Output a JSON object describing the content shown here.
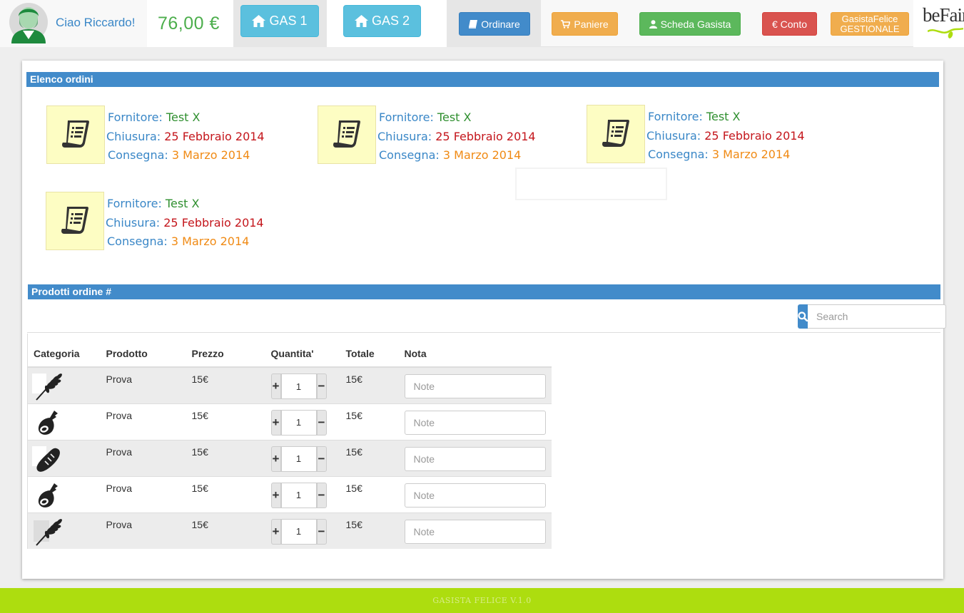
{
  "header": {
    "greeting": "Ciao Riccardo!",
    "balance": "76,00 €",
    "gas1_label": "GAS 1",
    "gas2_label": "GAS 2",
    "nav": {
      "ordinare": "Ordinare",
      "paniere": "Paniere",
      "scheda": "Scheda Gasista",
      "conto": "€ Conto",
      "gestionale_line1": "GasistaFelice",
      "gestionale_line2": "GESTIONALE"
    },
    "logo_text": "beFair"
  },
  "orders_section": {
    "title": "Elenco ordini",
    "labels": {
      "fornitore": "Fornitore:",
      "chiusura": "Chiusura:",
      "consegna": "Consegna:"
    },
    "orders": [
      {
        "fornitore": "Test X",
        "chiusura": "25 Febbraio 2014",
        "consegna": "3 Marzo 2014"
      },
      {
        "fornitore": "Test X",
        "chiusura": "25 Febbraio 2014",
        "consegna": "3 Marzo 2014"
      },
      {
        "fornitore": "Test X",
        "chiusura": "25 Febbraio 2014",
        "consegna": "3 Marzo 2014"
      },
      {
        "fornitore": "Test X",
        "chiusura": "25 Febbraio 2014",
        "consegna": "3 Marzo 2014"
      }
    ]
  },
  "products_section": {
    "title": "Prodotti ordine #",
    "search_placeholder": "Search",
    "columns": [
      "Categoria",
      "Prodotto",
      "Prezzo",
      "Quantita'",
      "Totale",
      "Nota"
    ],
    "rows": [
      {
        "category_icon": "wheat-icon",
        "prodotto": "Prova",
        "prezzo": "15€",
        "quantita": "1",
        "totale": "15€",
        "nota_placeholder": "Note"
      },
      {
        "category_icon": "ham-icon",
        "prodotto": "Prova",
        "prezzo": "15€",
        "quantita": "1",
        "totale": "15€",
        "nota_placeholder": "Note"
      },
      {
        "category_icon": "bread-icon",
        "prodotto": "Prova",
        "prezzo": "15€",
        "quantita": "1",
        "totale": "15€",
        "nota_placeholder": "Note"
      },
      {
        "category_icon": "ham-icon",
        "prodotto": "Prova",
        "prezzo": "15€",
        "quantita": "1",
        "totale": "15€",
        "nota_placeholder": "Note"
      },
      {
        "category_icon": "wheat-icon",
        "prodotto": "Prova",
        "prezzo": "15€",
        "quantita": "1",
        "totale": "15€",
        "nota_placeholder": "Note"
      }
    ],
    "plus_symbol": "+",
    "minus_symbol": "−"
  },
  "footer": {
    "text": "GASISTA FELICE V.1.0"
  },
  "colors": {
    "primary": "#428bca",
    "info": "#5bc0de",
    "warning": "#f0ad4e",
    "success": "#5cb85c",
    "danger": "#d9534f",
    "balance_green": "#4cae4c",
    "footer_lime": "#addd0f"
  }
}
